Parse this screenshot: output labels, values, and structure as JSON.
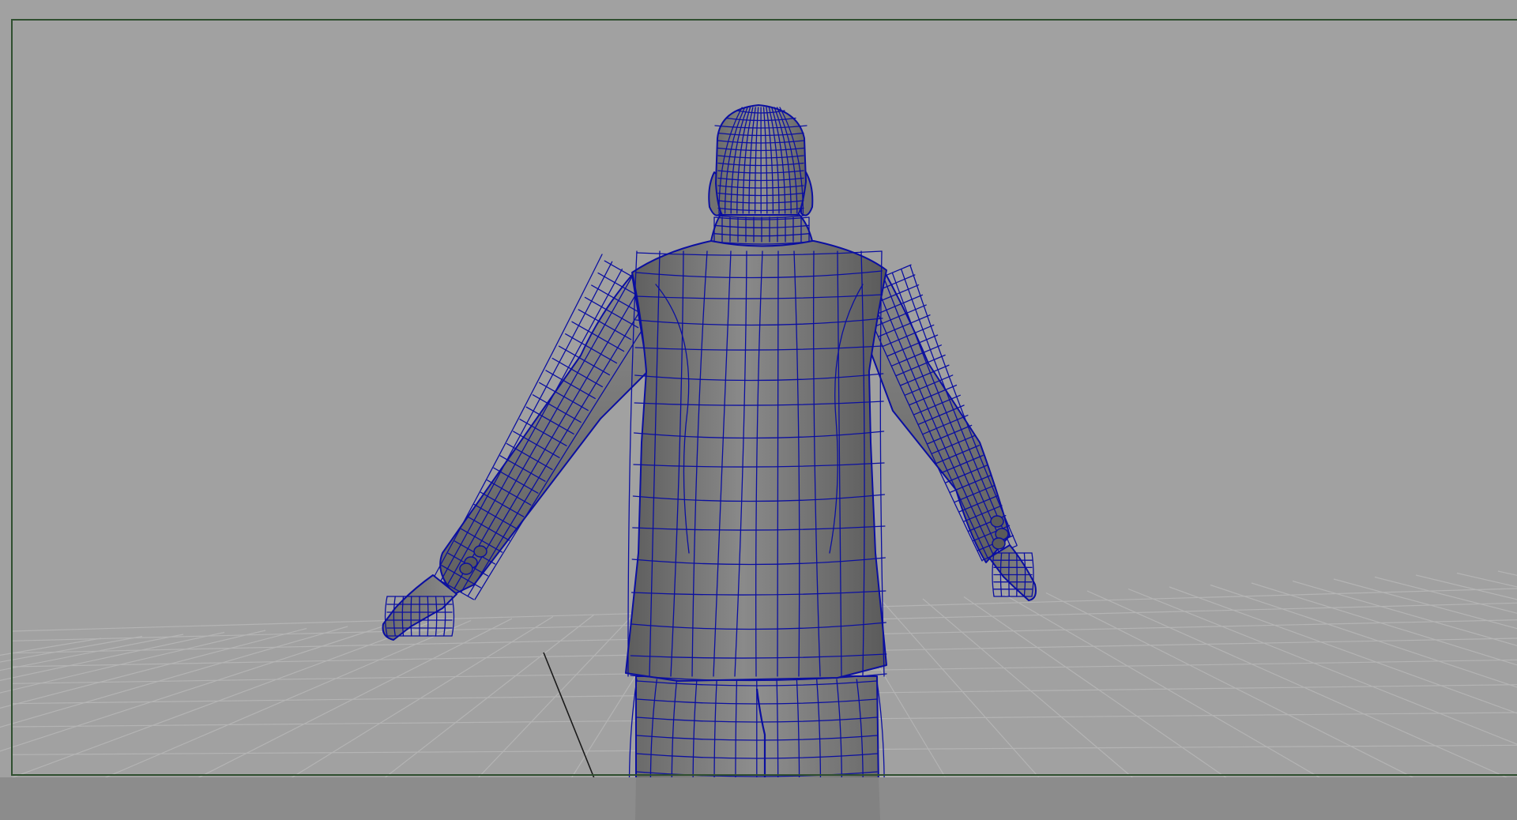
{
  "viewport": {
    "panel": "persp",
    "camera_view": "back",
    "display_mode": "smooth-shade-with-wireframe-on-shaded",
    "selection": "none",
    "grid_visible": true,
    "resolution_gate_visible": true
  },
  "scene": {
    "object": "suited-man-character-mesh",
    "pose": "A-pose",
    "visible_parts": [
      "head",
      "ears",
      "collar",
      "suit-jacket",
      "sleeves",
      "cuff-buttons",
      "hands",
      "trousers"
    ]
  },
  "colors": {
    "background": "#a1a1a1",
    "lower_band": "#8c8c8c",
    "grid": "#b4b4b4",
    "grid_axis": "#1a1a1a",
    "resolution_gate": "#2f4f2f",
    "wireframe": "#0b0fa0",
    "mesh_dark": "#5a5a5a",
    "mesh_light": "#8e8e8e"
  }
}
